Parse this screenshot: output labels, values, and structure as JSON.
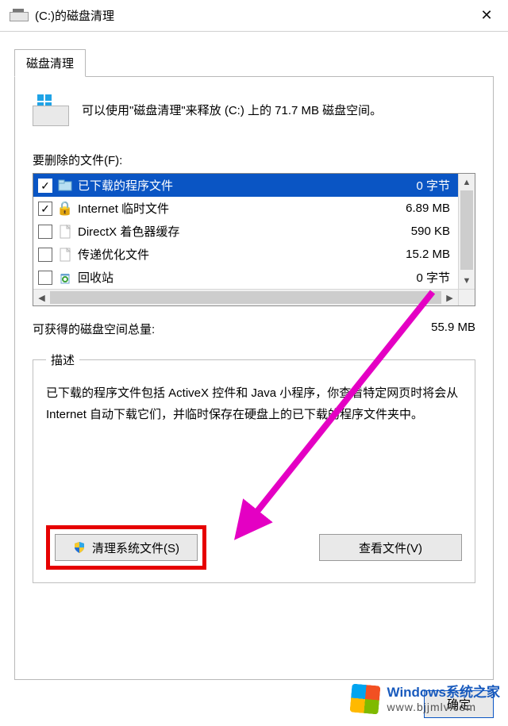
{
  "window": {
    "title": "(C:)的磁盘清理",
    "close_glyph": "✕"
  },
  "tab": {
    "label": "磁盘清理"
  },
  "intro": {
    "text": "可以使用\"磁盘清理\"来释放  (C:) 上的 71.7 MB 磁盘空间。"
  },
  "files_label": "要删除的文件(F):",
  "items": [
    {
      "name": "已下载的程序文件",
      "size": "0 字节",
      "checked": true,
      "icon": "folder",
      "selected": true
    },
    {
      "name": "Internet 临时文件",
      "size": "6.89 MB",
      "checked": true,
      "icon": "lock",
      "selected": false
    },
    {
      "name": "DirectX 着色器缓存",
      "size": "590 KB",
      "checked": false,
      "icon": "file",
      "selected": false
    },
    {
      "name": "传递优化文件",
      "size": "15.2 MB",
      "checked": false,
      "icon": "file",
      "selected": false
    },
    {
      "name": "回收站",
      "size": "0 字节",
      "checked": false,
      "icon": "recycle",
      "selected": false
    }
  ],
  "total": {
    "label": "可获得的磁盘空间总量:",
    "value": "55.9 MB"
  },
  "description": {
    "legend": "描述",
    "text": "已下载的程序文件包括 ActiveX 控件和 Java 小程序，你查看特定网页时将会从 Internet 自动下载它们，并临时保存在硬盘上的已下载的程序文件夹中。"
  },
  "buttons": {
    "clean_system": "清理系统文件(S)",
    "view_files": "查看文件(V)",
    "ok": "确定"
  },
  "watermark": {
    "line1": "Windows系统之家",
    "line2": "www.bjjmlv.com"
  },
  "colors": {
    "selection": "#0a55c4",
    "highlight_box": "#e60000",
    "arrow": "#e400c3"
  }
}
